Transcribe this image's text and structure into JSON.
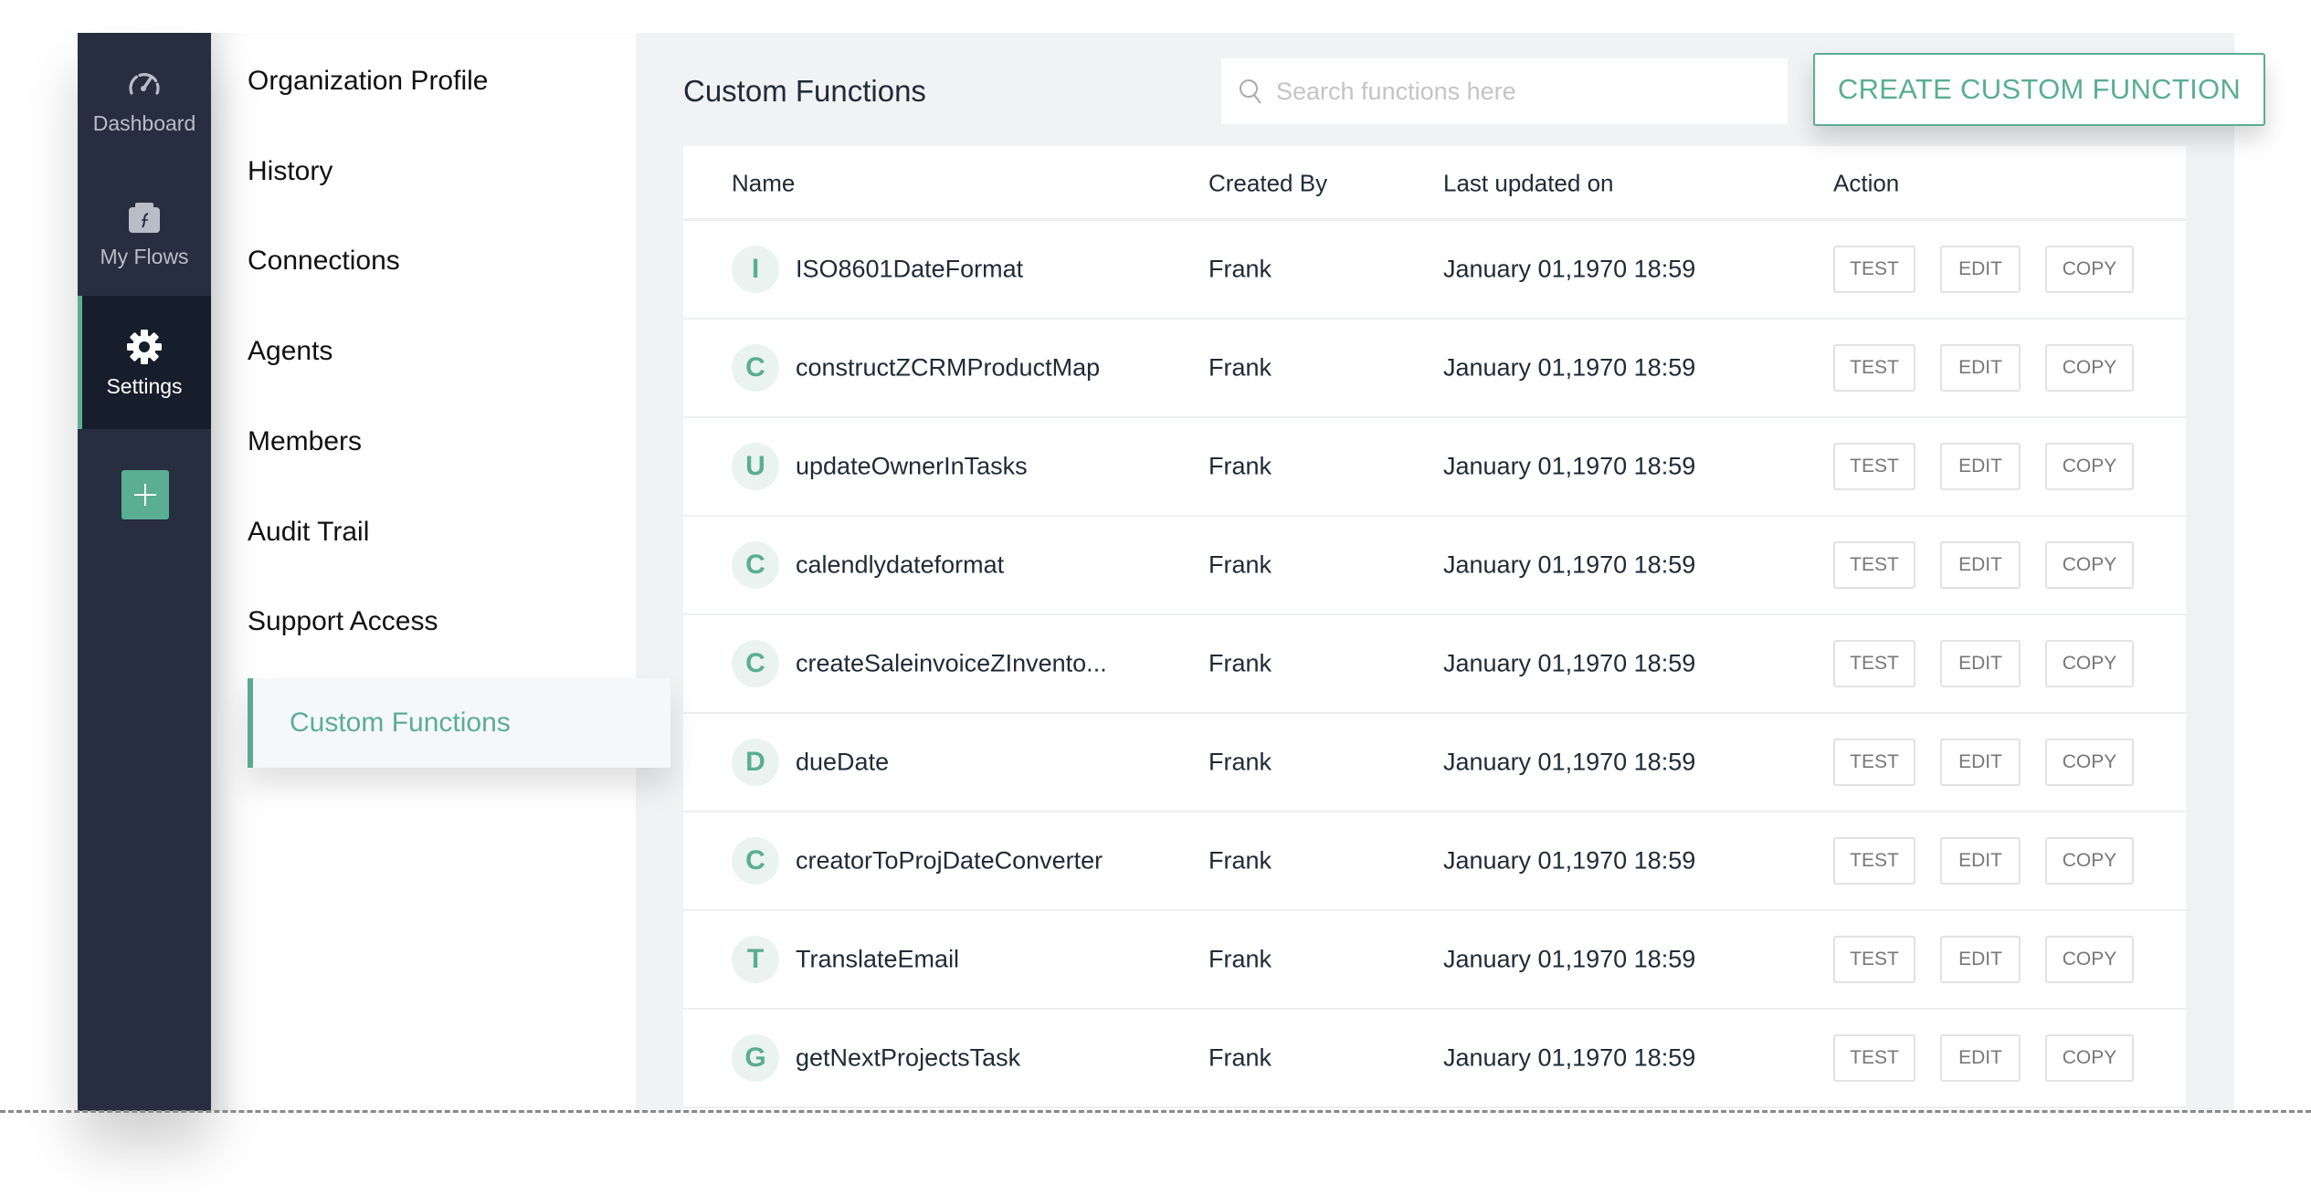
{
  "rail": {
    "items": [
      {
        "label": "Dashboard",
        "icon": "speedometer-icon"
      },
      {
        "label": "My Flows",
        "icon": "briefcase-function-icon"
      },
      {
        "label": "Settings",
        "icon": "gear-icon",
        "active": true
      }
    ],
    "add_icon": "plus-icon"
  },
  "menu": {
    "items": [
      {
        "label": "Organization Profile"
      },
      {
        "label": "History"
      },
      {
        "label": "Connections"
      },
      {
        "label": "Agents"
      },
      {
        "label": "Members"
      },
      {
        "label": "Audit Trail"
      },
      {
        "label": "Support Access"
      },
      {
        "label": "Custom Functions",
        "active": true
      }
    ]
  },
  "main": {
    "title": "Custom Functions",
    "search": {
      "placeholder": "Search functions here",
      "value": ""
    },
    "create_button": "CREATE CUSTOM FUNCTION",
    "table": {
      "columns": [
        "Name",
        "Created By",
        "Last updated on",
        "Action"
      ],
      "action_labels": {
        "test": "TEST",
        "edit": "EDIT",
        "copy": "COPY"
      },
      "rows": [
        {
          "initial": "I",
          "name": "ISO8601DateFormat",
          "created_by": "Frank",
          "updated": "January 01,1970 18:59"
        },
        {
          "initial": "C",
          "name": "constructZCRMProductMap",
          "created_by": "Frank",
          "updated": "January 01,1970 18:59"
        },
        {
          "initial": "U",
          "name": "updateOwnerInTasks",
          "created_by": "Frank",
          "updated": "January 01,1970 18:59"
        },
        {
          "initial": "C",
          "name": "calendlydateformat",
          "created_by": "Frank",
          "updated": "January 01,1970 18:59"
        },
        {
          "initial": "C",
          "name": "createSaleinvoiceZInvento...",
          "created_by": "Frank",
          "updated": "January 01,1970 18:59"
        },
        {
          "initial": "D",
          "name": "dueDate",
          "created_by": "Frank",
          "updated": "January 01,1970 18:59"
        },
        {
          "initial": "C",
          "name": "creatorToProjDateConverter",
          "created_by": "Frank",
          "updated": "January 01,1970 18:59"
        },
        {
          "initial": "T",
          "name": "TranslateEmail",
          "created_by": "Frank",
          "updated": "January 01,1970 18:59"
        },
        {
          "initial": "G",
          "name": "getNextProjectsTask",
          "created_by": "Frank",
          "updated": "January 01,1970 18:59"
        }
      ]
    }
  },
  "colors": {
    "accent": "#5aae91",
    "rail_bg": "#272e40",
    "rail_active_bg": "#161d2b",
    "main_bg": "#f1f2f4"
  }
}
